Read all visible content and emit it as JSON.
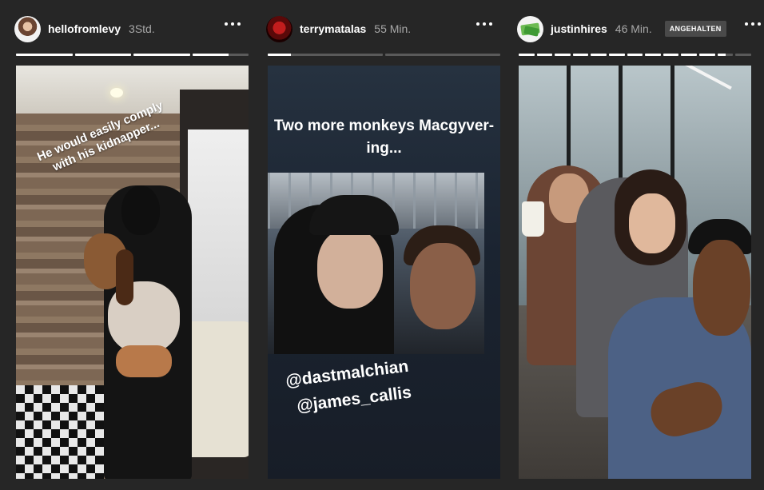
{
  "stories": [
    {
      "username": "hellofromlevy",
      "time": "3Std.",
      "progress": [
        1,
        1,
        1,
        0.65
      ],
      "caption": "He would easily comply with his kidnapper..."
    },
    {
      "username": "terrymatalas",
      "time": "55 Min.",
      "progress": [
        0.2,
        0
      ],
      "caption": "Two more monkeys Macgyver-ing...",
      "tags": [
        "@dastmalchian",
        "@james_callis"
      ]
    },
    {
      "username": "justinhires",
      "time": "46 Min.",
      "badge": "ANGEHALTEN",
      "progress": [
        1,
        1,
        1,
        1,
        1,
        1,
        1,
        1,
        1,
        1,
        1,
        0.5,
        0
      ]
    }
  ],
  "icons": {
    "more": "more-horizontal-icon"
  }
}
